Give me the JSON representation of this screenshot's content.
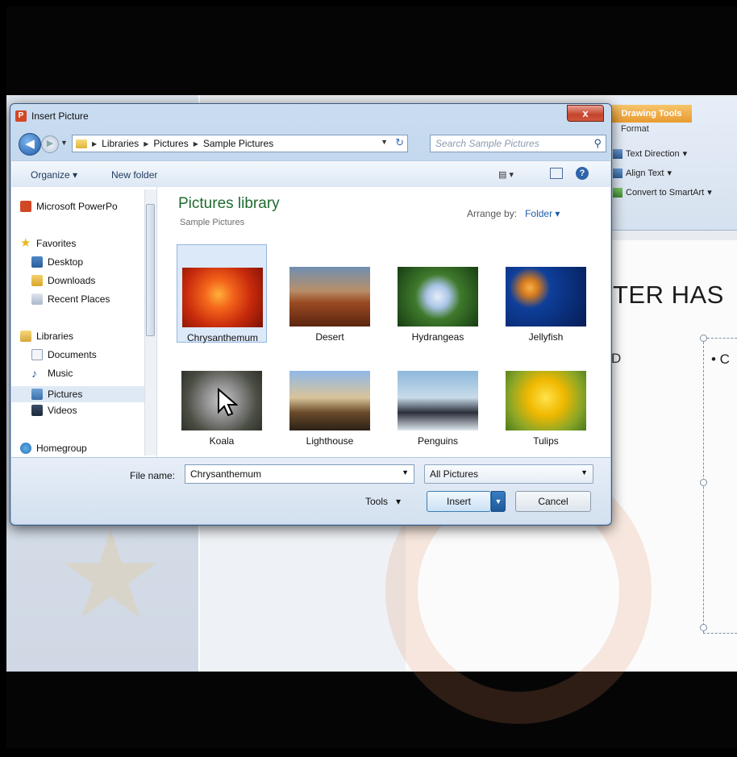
{
  "dialog": {
    "title": "Insert Picture",
    "close_label": "x",
    "address": [
      "Libraries",
      "Pictures",
      "Sample Pictures"
    ],
    "search_placeholder": "Search Sample Pictures",
    "organize": "Organize ▾",
    "new_folder": "New folder"
  },
  "nav": {
    "app_item": "Microsoft PowerPo",
    "favorites": "Favorites",
    "desktop": "Desktop",
    "downloads": "Downloads",
    "recent": "Recent Places",
    "libraries": "Libraries",
    "documents": "Documents",
    "music": "Music",
    "pictures": "Pictures",
    "videos": "Videos",
    "homegroup": "Homegroup"
  },
  "library": {
    "title": "Pictures library",
    "subtitle": "Sample Pictures",
    "arrange_label": "Arrange by:",
    "arrange_value": "Folder"
  },
  "files": [
    "Chrysanthemum",
    "Desert",
    "Hydrangeas",
    "Jellyfish",
    "Koala",
    "Lighthouse",
    "Penguins",
    "Tulips"
  ],
  "bottom": {
    "file_name_label": "File name:",
    "file_name_value": "Chrysanthemum",
    "filter": "All Pictures",
    "tools": "Tools",
    "insert": "Insert",
    "cancel": "Cancel"
  },
  "ribbon": {
    "context_tab": "Drawing Tools",
    "format_tab": "Format",
    "text_direction": "Text Direction",
    "align_text": "Align Text",
    "convert": "Convert to SmartArt"
  },
  "slide": {
    "title_fragment": "TER HAS",
    "left_fragment": "D",
    "bullet_fragment": "•  C"
  }
}
